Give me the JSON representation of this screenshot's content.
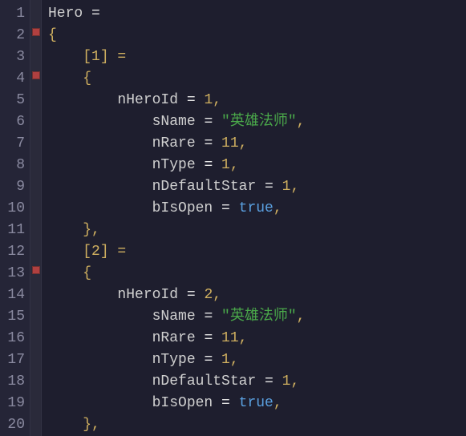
{
  "lines": {
    "l1": {
      "a": "Hero",
      "b": " = "
    },
    "l2": {
      "a": "{"
    },
    "l3": {
      "a": "    [",
      "b": "1",
      "c": "] ="
    },
    "l4": {
      "a": "    {"
    },
    "l5": {
      "a": "        nHeroId",
      "b": " = ",
      "c": "1",
      "d": ","
    },
    "l6": {
      "a": "            sName",
      "b": " = ",
      "c": "\"英雄法师\"",
      "d": ","
    },
    "l7": {
      "a": "            nRare",
      "b": " = ",
      "c": "11",
      "d": ","
    },
    "l8": {
      "a": "            nType",
      "b": " = ",
      "c": "1",
      "d": ","
    },
    "l9": {
      "a": "            nDefaultStar",
      "b": " = ",
      "c": "1",
      "d": ","
    },
    "l10": {
      "a": "            bIsOpen",
      "b": " = ",
      "c": "true",
      "d": ","
    },
    "l11": {
      "a": "    },",
      "b": ""
    },
    "l12": {
      "a": "    [",
      "b": "2",
      "c": "] ="
    },
    "l13": {
      "a": "    {"
    },
    "l14": {
      "a": "        nHeroId",
      "b": " = ",
      "c": "2",
      "d": ","
    },
    "l15": {
      "a": "            sName",
      "b": " = ",
      "c": "\"英雄法师\"",
      "d": ","
    },
    "l16": {
      "a": "            nRare",
      "b": " = ",
      "c": "11",
      "d": ","
    },
    "l17": {
      "a": "            nType",
      "b": " = ",
      "c": "1",
      "d": ","
    },
    "l18": {
      "a": "            nDefaultStar",
      "b": " = ",
      "c": "1",
      "d": ","
    },
    "l19": {
      "a": "            bIsOpen",
      "b": " = ",
      "c": "true",
      "d": ","
    },
    "l20": {
      "a": "    },"
    }
  },
  "gutter": {
    "n1": "1",
    "n2": "2",
    "n3": "3",
    "n4": "4",
    "n5": "5",
    "n6": "6",
    "n7": "7",
    "n8": "8",
    "n9": "9",
    "n10": "10",
    "n11": "11",
    "n12": "12",
    "n13": "13",
    "n14": "14",
    "n15": "15",
    "n16": "16",
    "n17": "17",
    "n18": "18",
    "n19": "19",
    "n20": "20"
  }
}
